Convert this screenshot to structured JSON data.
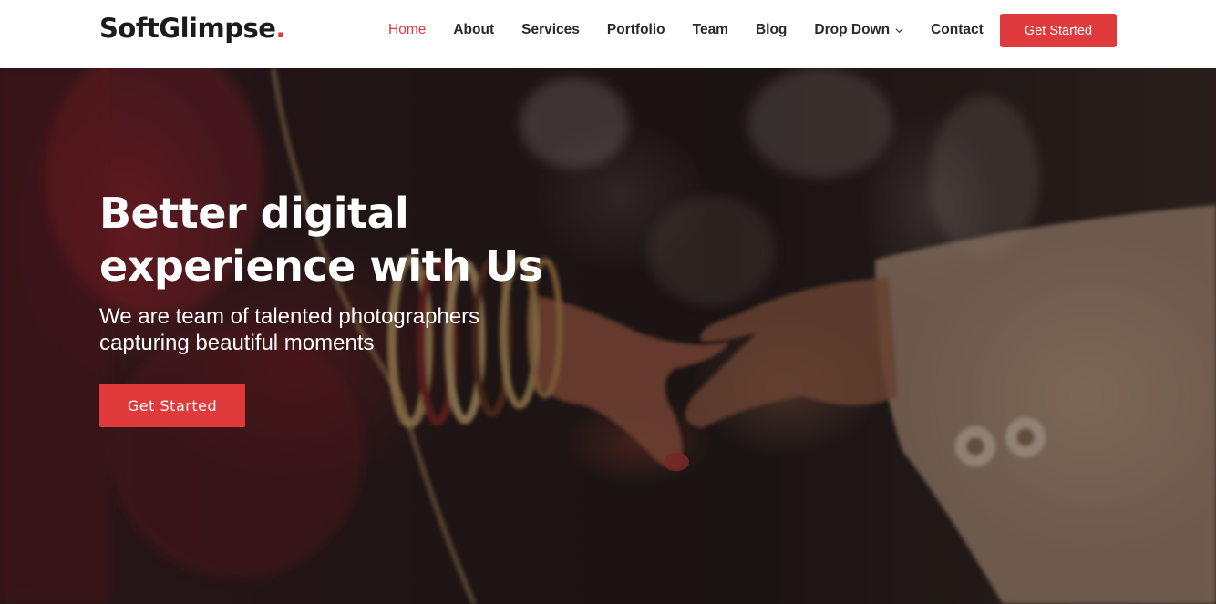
{
  "brand": {
    "name": "SoftGlimpse",
    "dot": "."
  },
  "nav": {
    "items": [
      {
        "label": "Home",
        "active": true
      },
      {
        "label": "About"
      },
      {
        "label": "Services"
      },
      {
        "label": "Portfolio"
      },
      {
        "label": "Team"
      },
      {
        "label": "Blog"
      },
      {
        "label": "Drop Down",
        "dropdown": true,
        "icon": "chevron-down-icon"
      },
      {
        "label": "Contact"
      }
    ],
    "cta_label": "Get Started"
  },
  "hero": {
    "title_line1": "Better digital",
    "title_line2": "experience with Us",
    "subtitle_line1": "We are team of talented photographers",
    "subtitle_line2": "capturing beautiful moments",
    "cta_label": "Get Started"
  },
  "colors": {
    "accent": "#e03a3c",
    "text_dark": "#2a2a2a",
    "header_bg": "#ffffff"
  }
}
